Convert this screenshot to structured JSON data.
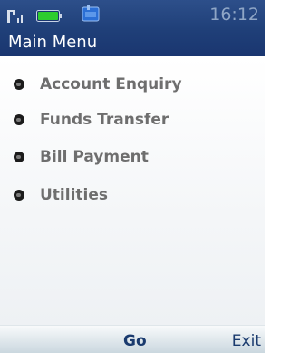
{
  "status_bar": {
    "time": "16:12",
    "icons": [
      "signal-icon",
      "battery-icon",
      "app-icon"
    ]
  },
  "header": {
    "title": "Main Menu"
  },
  "menu": {
    "items": [
      {
        "label": "Account Enquiry"
      },
      {
        "label": "Funds Transfer"
      },
      {
        "label": "Bill Payment"
      },
      {
        "label": "Utilities"
      }
    ]
  },
  "softkeys": {
    "center": "Go",
    "right": "Exit"
  },
  "colors": {
    "header_bg": "#1f3f78",
    "battery_green": "#2ecc2e",
    "menu_text": "#6e6e6e",
    "softkey_text": "#1a3a6e"
  }
}
